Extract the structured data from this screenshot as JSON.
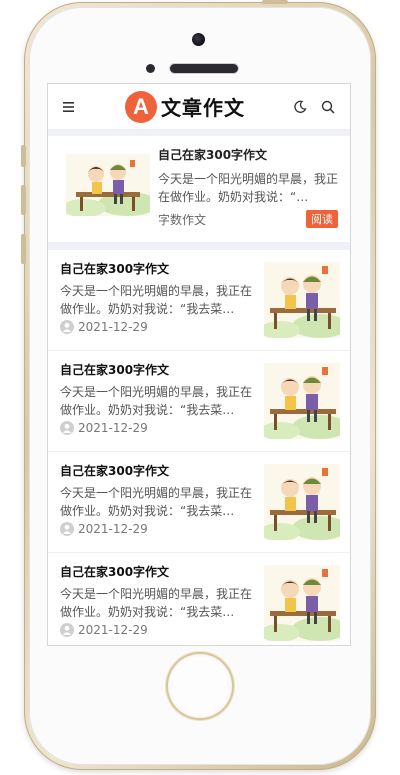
{
  "header": {
    "logo_letter": "A",
    "logo_text": "文章作文",
    "menu_icon": "menu-icon",
    "theme_icon": "moon-icon",
    "search_icon": "search-icon"
  },
  "featured": {
    "title": "自己在家300字作文",
    "summary": "今天是一个阳光明媚的早晨，我正在做作业。奶奶对我说：“…",
    "category": "字数作文",
    "read_label": "阅读"
  },
  "articles": [
    {
      "title": "自己在家300字作文",
      "summary": "今天是一个阳光明媚的早晨，我正在做作业。奶奶对我说：“我去菜…",
      "date": "2021-12-29"
    },
    {
      "title": "自己在家300字作文",
      "summary": "今天是一个阳光明媚的早晨，我正在做作业。奶奶对我说：“我去菜…",
      "date": "2021-12-29"
    },
    {
      "title": "自己在家300字作文",
      "summary": "今天是一个阳光明媚的早晨，我正在做作业。奶奶对我说：“我去菜…",
      "date": "2021-12-29"
    },
    {
      "title": "自己在家300字作文",
      "summary": "今天是一个阳光明媚的早晨，我正在做作业。奶奶对我说：“我去菜…",
      "date": "2021-12-29"
    }
  ],
  "colors": {
    "accent": "#f0623a",
    "page_bg": "#f0f0f8"
  }
}
